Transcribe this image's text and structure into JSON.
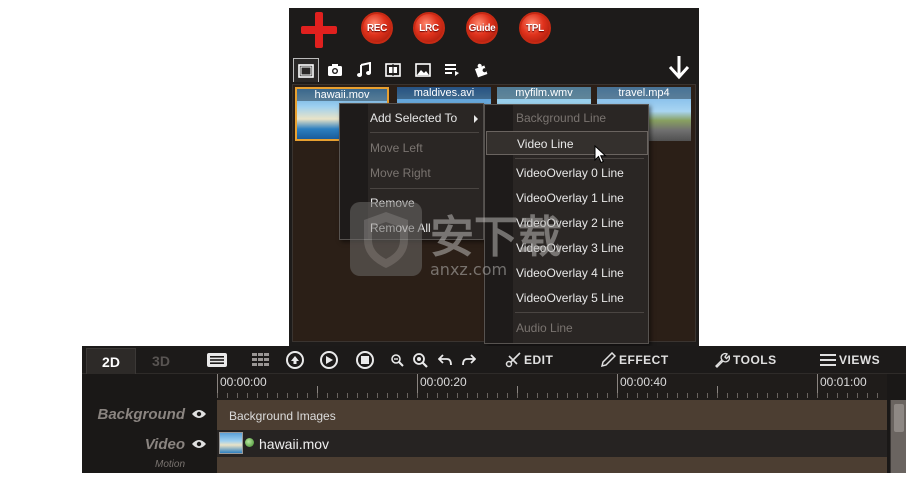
{
  "top_toolbar": {
    "buttons": [
      "REC",
      "LRC",
      "Guide",
      "TPL"
    ],
    "add_icon": "plus-icon",
    "download_icon": "arrow-down-icon"
  },
  "media_tabs": [
    "film-icon",
    "camera-icon",
    "music-icon",
    "transition-icon",
    "image-icon",
    "text-icon",
    "puzzle-icon"
  ],
  "clips": [
    {
      "name": "hawaii.mov",
      "selected": true
    },
    {
      "name": "maldives.avi",
      "selected": false
    },
    {
      "name": "myfilm.wmv",
      "selected": false
    },
    {
      "name": "travel.mp4",
      "selected": false
    }
  ],
  "context_menu": {
    "items": [
      {
        "label": "Add Selected To",
        "enabled": true,
        "submenu": true
      },
      {
        "label": "Move Left",
        "enabled": false
      },
      {
        "label": "Move Right",
        "enabled": false
      },
      {
        "label": "Remove",
        "enabled": true
      },
      {
        "label": "Remove All",
        "enabled": true
      }
    ]
  },
  "submenu": {
    "items": [
      {
        "label": "Background Line",
        "enabled": false
      },
      {
        "label": "Video Line",
        "enabled": true,
        "hover": true
      },
      {
        "label": "VideoOverlay 0 Line",
        "enabled": true
      },
      {
        "label": "VideoOverlay 1 Line",
        "enabled": true
      },
      {
        "label": "VideoOverlay 2 Line",
        "enabled": true
      },
      {
        "label": "VideoOverlay 3 Line",
        "enabled": true
      },
      {
        "label": "VideoOverlay 4 Line",
        "enabled": true
      },
      {
        "label": "VideoOverlay 5 Line",
        "enabled": true
      },
      {
        "label": "Audio Line",
        "enabled": false
      }
    ]
  },
  "watermark": {
    "text": "安下载",
    "domain": "anxz.com"
  },
  "timeline": {
    "view_tabs": [
      "2D",
      "3D"
    ],
    "active_view": "2D",
    "menu_buttons": [
      "EDIT",
      "EFFECT",
      "TOOLS",
      "VIEWS"
    ],
    "ruler_labels": [
      "00:00:00",
      "00:00:20",
      "00:00:40",
      "00:01:00"
    ],
    "tracks": [
      {
        "name": "Background",
        "content": "Background Images"
      },
      {
        "name": "Video",
        "sublabel": "Motion",
        "content": "hawaii.mov"
      }
    ]
  },
  "colors": {
    "accent_red": "#e0201e",
    "panel_bg": "#1d1b1a",
    "clips_bg": "#2b1f17",
    "selection_orange": "#e8a030",
    "track_bg": "#4c3e32"
  }
}
